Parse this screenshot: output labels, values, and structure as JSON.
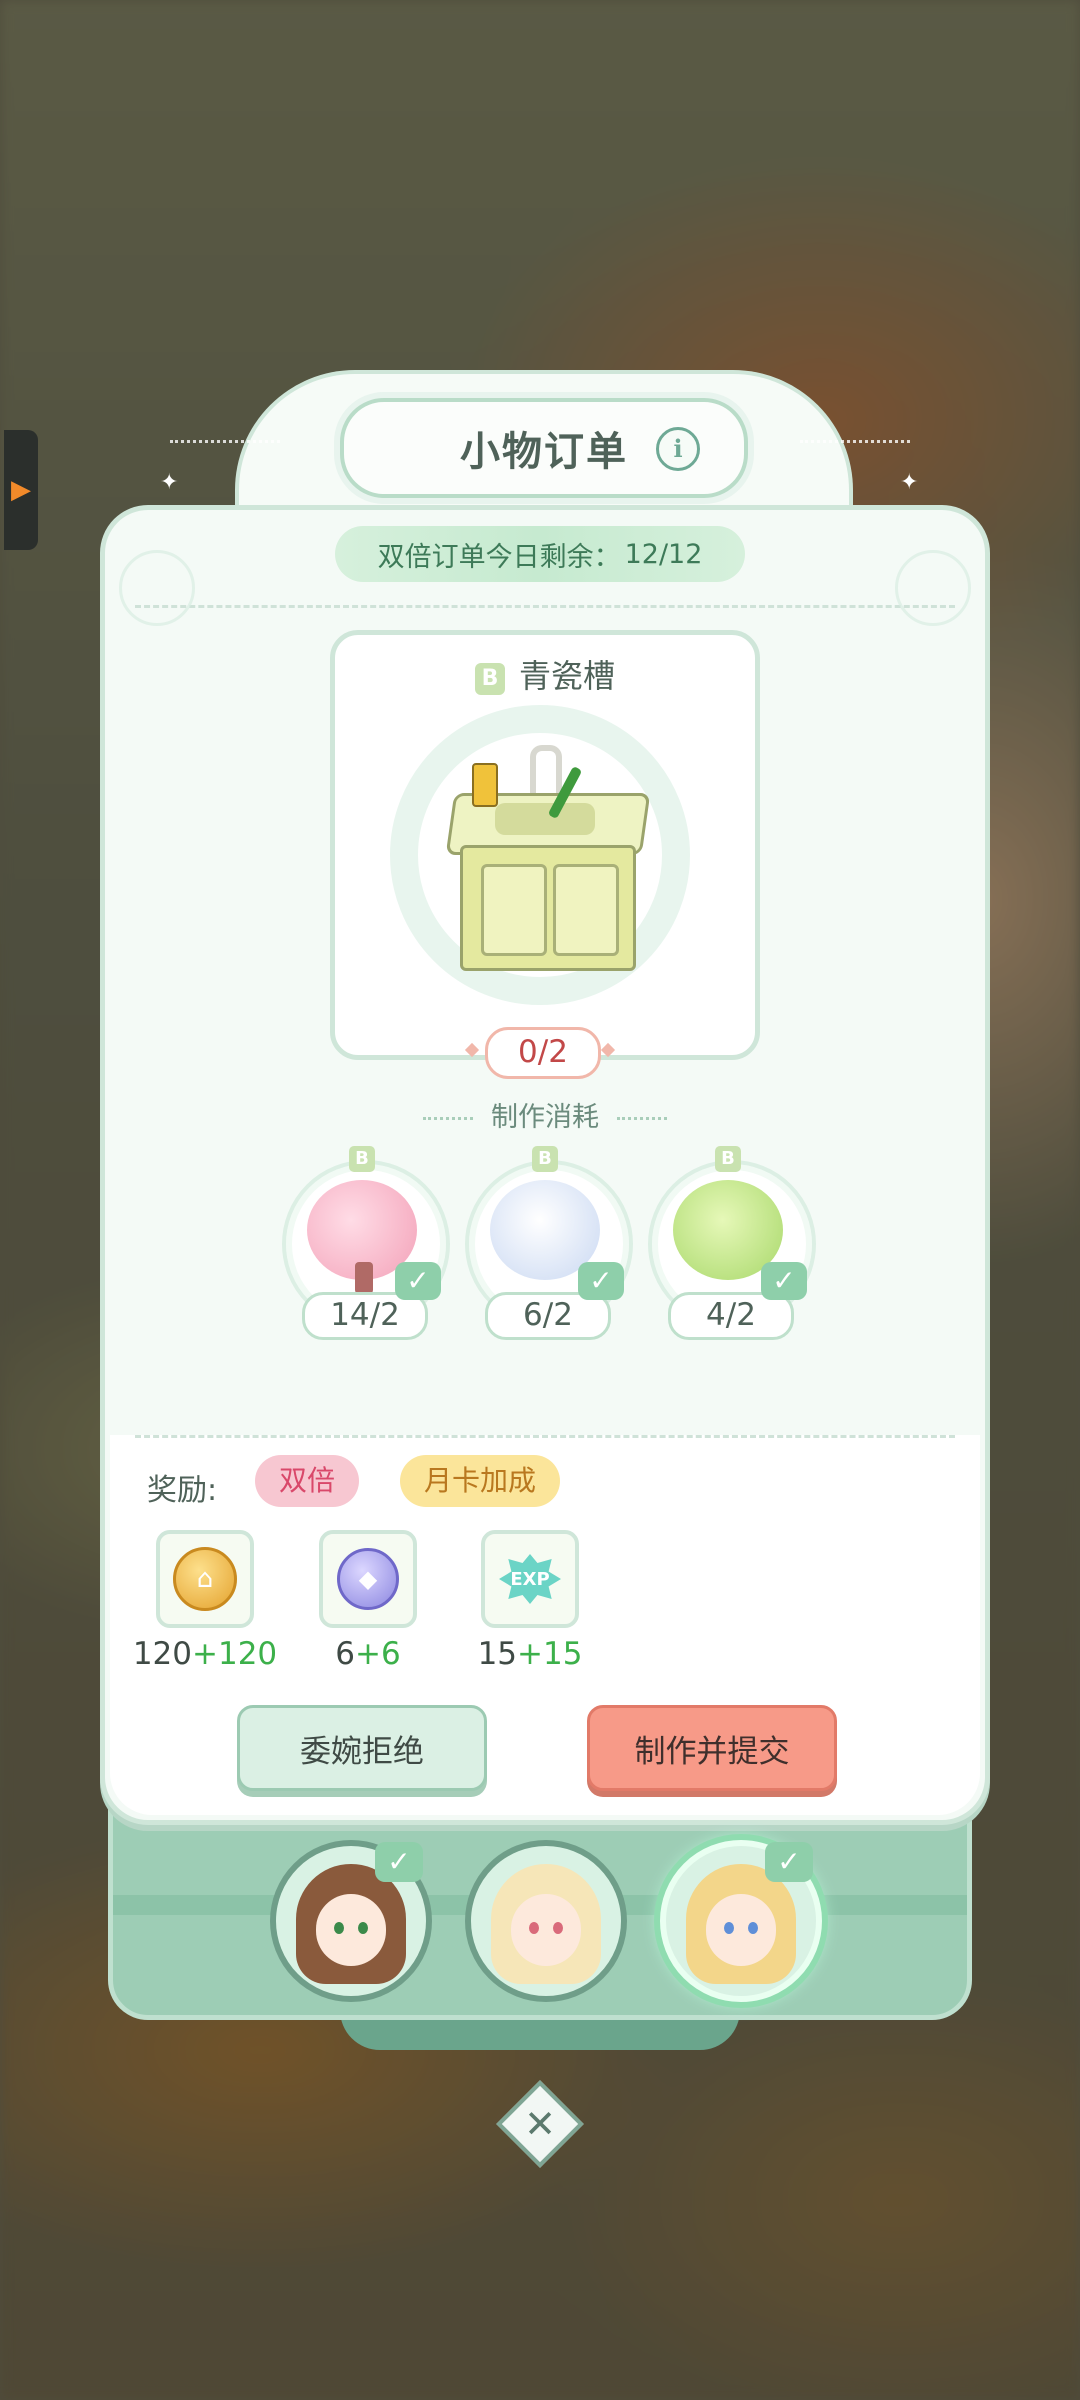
{
  "dialog": {
    "title": "小物订单",
    "info_icon": "i",
    "banner_label": "双倍订单今日剩余：",
    "banner_value": "12/12"
  },
  "item": {
    "grade": "B",
    "name": "青瓷槽",
    "progress": "0/2"
  },
  "consume": {
    "title": "制作消耗",
    "materials": [
      {
        "grade": "B",
        "count": "14/2",
        "icon": "pink-flower-tree-icon"
      },
      {
        "grade": "B",
        "count": "6/2",
        "icon": "white-lily-icon"
      },
      {
        "grade": "B",
        "count": "4/2",
        "icon": "green-clover-bush-icon"
      }
    ]
  },
  "rewards": {
    "label": "奖励:",
    "tags": [
      "双倍",
      "月卡加成"
    ],
    "items": [
      {
        "icon": "gold-coin-icon",
        "base": "120",
        "bonus": "+120"
      },
      {
        "icon": "blue-gem-icon",
        "base": "6",
        "bonus": "+6"
      },
      {
        "icon": "exp-star-icon",
        "glyph": "EXP",
        "base": "15",
        "bonus": "+15"
      }
    ]
  },
  "buttons": {
    "decline": "委婉拒绝",
    "submit": "制作并提交"
  },
  "characters": {
    "selected_index": 2,
    "checked": [
      true,
      false,
      true
    ]
  },
  "colors": {
    "accent_green": "#8ecfaa",
    "bonus_green": "#3cb04a",
    "submit_red": "#f79a88",
    "progress_red": "#c24848"
  }
}
